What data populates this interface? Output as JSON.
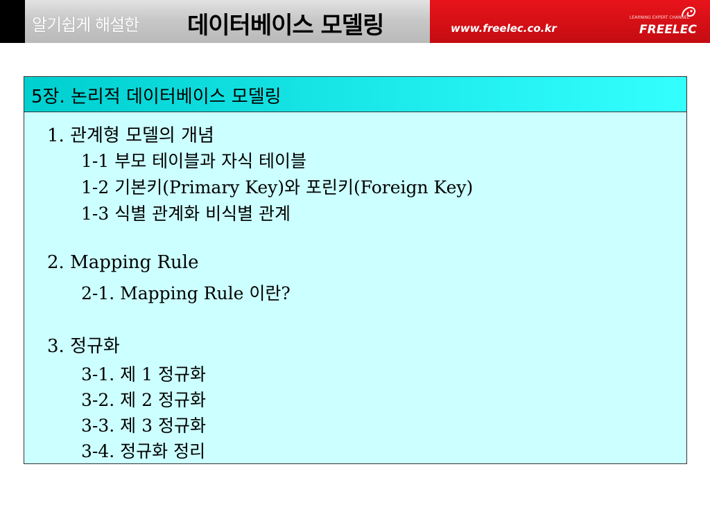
{
  "header": {
    "subtitle": "알기쉽게 해설한",
    "title": "데이터베이스 모델링",
    "url": "www.freelec.co.kr",
    "logo_small": "LEARNING EXPERT CHANNEL",
    "logo_name": "FREELEC"
  },
  "slide": {
    "title": "5장. 논리적 데이터베이스 모델링",
    "sections": [
      {
        "heading": "1. 관계형 모델의 개념",
        "items": [
          "1-1  부모 테이블과 자식 테이블",
          "1-2  기본키(Primary Key)와 포린키(Foreign Key)",
          "1-3  식별 관계화 비식별 관계"
        ]
      },
      {
        "heading": "2. Mapping Rule",
        "items": [
          "2-1. Mapping Rule 이란?"
        ]
      },
      {
        "heading": "3. 정규화",
        "items": [
          "3-1.  제 1 정규화",
          "3-2.  제 2 정규화",
          "3-3.  제 3 정규화",
          "3-4.  정규화 정리"
        ]
      }
    ]
  },
  "colors": {
    "title_bar": "#33ffff",
    "content_bg": "#ccffff",
    "banner_red": "#d81016"
  }
}
